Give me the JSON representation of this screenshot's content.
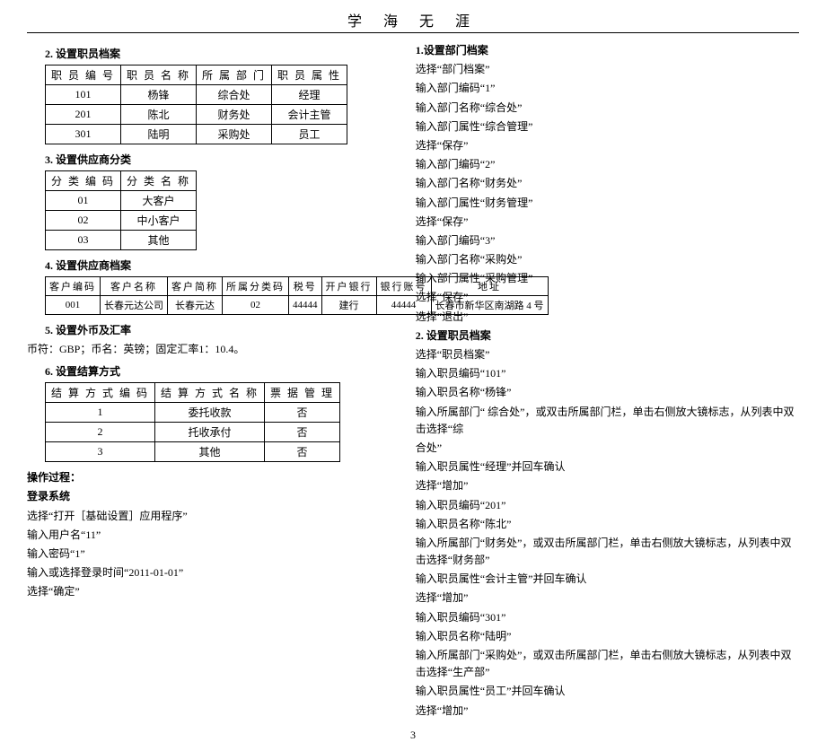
{
  "header": {
    "title": "学 海 无 涯"
  },
  "left": {
    "s2": {
      "heading": "2. 设置职员档案",
      "cols": [
        "职 员 编  号",
        "职 员 名 称",
        "所 属 部  门",
        "职 员 属  性"
      ],
      "rows": [
        [
          "101",
          "杨锋",
          "综合处",
          "经理"
        ],
        [
          "201",
          "陈北",
          "财务处",
          "会计主管"
        ],
        [
          "301",
          "陆明",
          "采购处",
          "员工"
        ]
      ]
    },
    "s3": {
      "heading": "3. 设置供应商分类",
      "cols": [
        "分 类 编  码",
        "分 类 名 称"
      ],
      "rows": [
        [
          "01",
          "大客户"
        ],
        [
          "02",
          "中小客户"
        ],
        [
          "03",
          "其他"
        ]
      ]
    },
    "s4": {
      "heading": "4. 设置供应商档案",
      "cols": [
        "客户编码",
        "客户名称",
        "客户简称",
        "所属分类码",
        "税号",
        "开户银行",
        "银行账号",
        "地址"
      ],
      "rows": [
        [
          "001",
          "长春元达公司",
          "长春元达",
          "02",
          "44444",
          "建行",
          "44444",
          "长春市新华区南湖路 4 号"
        ]
      ]
    },
    "s5": {
      "heading": "5. 设置外币及汇率",
      "line": "币符：GBP；币名：英镑；固定汇率1：10.4。"
    },
    "s6": {
      "heading": "6. 设置结算方式",
      "cols": [
        "结 算 方 式 编 码",
        "结 算 方 式 名 称",
        "票 据  管 理"
      ],
      "rows": [
        [
          "1",
          "委托收款",
          "否"
        ],
        [
          "2",
          "托收承付",
          "否"
        ],
        [
          "3",
          "其他",
          "否"
        ]
      ]
    },
    "ops": {
      "heading": "操作过程：",
      "login": "登录系统",
      "steps": [
        "选择“打开［基础设置］应用程序”",
        "输入用户名“11”",
        "输入密码“1”",
        "输入或选择登录时间“2011-01-01”",
        "选择“确定”"
      ]
    }
  },
  "right": {
    "r1": {
      "heading": "1.设置部门档案",
      "steps": [
        "选择“部门档案”",
        "输入部门编码“1”",
        "输入部门名称“综合处”",
        "输入部门属性“综合管理”",
        "选择“保存”",
        "输入部门编码“2”",
        "输入部门名称“财务处”",
        "输入部门属性“财务管理”",
        "选择“保存”",
        "输入部门编码“3”",
        "输入部门名称“采购处”",
        "输入部门属性“采购管理”",
        "选择“保存”",
        "选择“退出”"
      ]
    },
    "r2": {
      "heading": "2. 设置职员档案",
      "stepsA": [
        "选择“职员档案”",
        "输入职员编码“101”",
        "输入职员名称“杨锋”",
        "输入所属部门“ 综合处”，或双击所属部门栏，单击右侧放大镜标志，从列表中双击选择“综"
      ],
      "lineA2": "合处”",
      "stepsB": [
        "输入职员属性“经理”并回车确认",
        "选择“增加”",
        "输入职员编码“201”",
        "输入职员名称“陈北”"
      ],
      "lineB": "输入所属部门“财务处”，或双击所属部门栏，单击右侧放大镜标志，从列表中双击选择“财务部”",
      "stepsC": [
        "输入职员属性“会计主管”并回车确认",
        "选择“增加”",
        "输入职员编码“301”",
        "输入职员名称“陆明”"
      ],
      "lineD": "输入所属部门“采购处”，或双击所属部门栏，单击右侧放大镜标志，从列表中双击选择“生产部”",
      "stepsE": [
        "输入职员属性“员工”并回车确认",
        "选择“增加”"
      ]
    }
  },
  "pageNumber": "3"
}
